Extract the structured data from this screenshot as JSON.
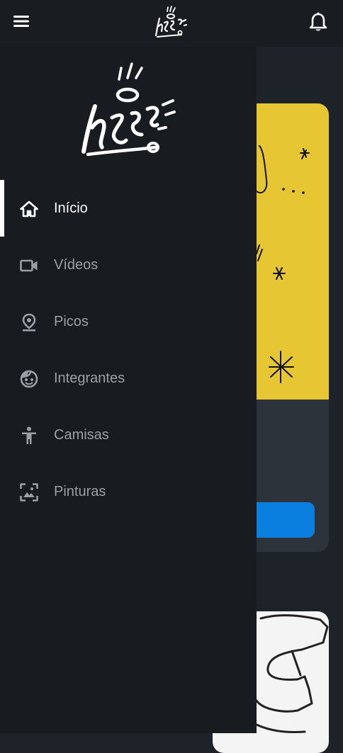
{
  "app": {
    "logo_icon": "hero-tag-logo",
    "menu_icon": "hamburger-menu-icon",
    "notification_icon": "bell-icon"
  },
  "drawer": {
    "items": [
      {
        "label": "Início",
        "icon": "home-icon",
        "active": true
      },
      {
        "label": "Vídeos",
        "icon": "video-camera-icon",
        "active": false
      },
      {
        "label": "Picos",
        "icon": "location-pin-icon",
        "active": false
      },
      {
        "label": "Integrantes",
        "icon": "face-icon",
        "active": false
      },
      {
        "label": "Camisas",
        "icon": "person-icon",
        "active": false
      },
      {
        "label": "Pinturas",
        "icon": "image-icon",
        "active": false
      }
    ]
  },
  "colors": {
    "drawer_bg": "#181b1f",
    "appbar_bg": "#191c20",
    "active_text": "#ffffff",
    "inactive_text": "#9aa0a6",
    "card_art_yellow": "#e6c633",
    "card_button_blue": "#0a7fe0"
  }
}
